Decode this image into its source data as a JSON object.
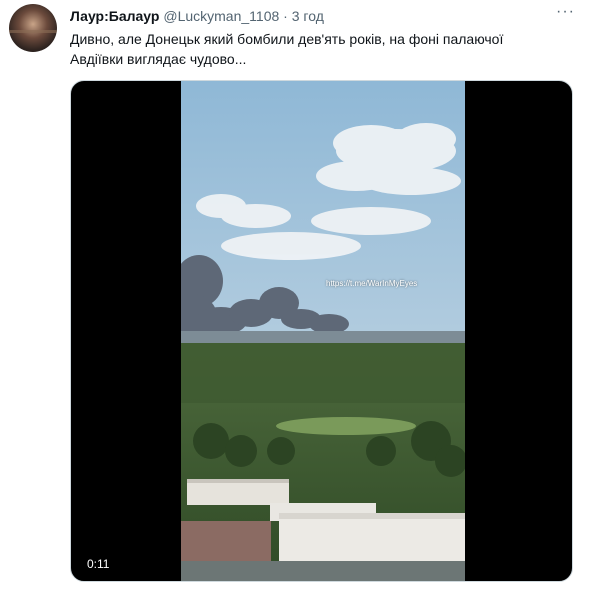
{
  "tweet": {
    "author_name": "Лаур:Балаур",
    "author_handle": "@Luckyman_1108",
    "separator": "·",
    "timestamp": "3 год",
    "more_icon": "more-horizontal-icon",
    "text": "Дивно, але Донецьк який бомбили дев'ять років, на фоні палаючої Авдіївки виглядає чудово...",
    "media": {
      "watermark": "https://t.me/WarInMyEyes",
      "duration": "0:11"
    }
  }
}
